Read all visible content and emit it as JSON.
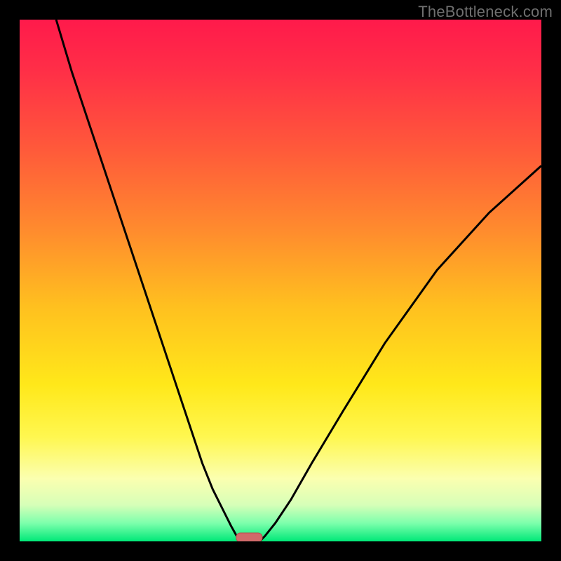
{
  "watermark": "TheBottleneck.com",
  "colors": {
    "frame": "#000000",
    "gradient_stops": [
      {
        "offset": 0.0,
        "color": "#ff1a4b"
      },
      {
        "offset": 0.1,
        "color": "#ff2f47"
      },
      {
        "offset": 0.25,
        "color": "#ff5a3a"
      },
      {
        "offset": 0.4,
        "color": "#ff8a2e"
      },
      {
        "offset": 0.55,
        "color": "#ffc01f"
      },
      {
        "offset": 0.7,
        "color": "#ffe81a"
      },
      {
        "offset": 0.8,
        "color": "#fff750"
      },
      {
        "offset": 0.88,
        "color": "#fbffb0"
      },
      {
        "offset": 0.93,
        "color": "#d7ffb8"
      },
      {
        "offset": 0.965,
        "color": "#7dffac"
      },
      {
        "offset": 1.0,
        "color": "#00e878"
      }
    ],
    "curve": "#000000",
    "marker_fill": "#d16a6a",
    "marker_stroke": "#b94f4f"
  },
  "chart_data": {
    "type": "line",
    "title": "",
    "xlabel": "",
    "ylabel": "",
    "xlim": [
      0,
      100
    ],
    "ylim": [
      0,
      100
    ],
    "grid": false,
    "legend": false,
    "series": [
      {
        "name": "left-curve",
        "x": [
          7,
          10,
          14,
          18,
          22,
          26,
          30,
          33,
          35,
          37,
          39,
          40.5,
          41.5,
          42,
          42.5
        ],
        "y": [
          100,
          90,
          78,
          66,
          54,
          42,
          30,
          21,
          15,
          10,
          6,
          3,
          1.2,
          0.4,
          0
        ]
      },
      {
        "name": "right-curve",
        "x": [
          46,
          47,
          49,
          52,
          56,
          62,
          70,
          80,
          90,
          100
        ],
        "y": [
          0,
          1,
          3.5,
          8,
          15,
          25,
          38,
          52,
          63,
          72
        ]
      }
    ],
    "annotations": [
      {
        "name": "min-marker",
        "shape": "pill",
        "x_center": 44,
        "y": 0,
        "width_x": 5
      }
    ]
  }
}
